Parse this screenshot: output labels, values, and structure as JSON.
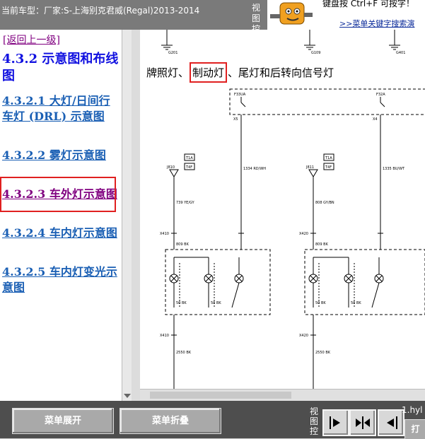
{
  "topbar": {
    "car_model": "当前车型：厂家:S-上海别克君威(Regal)2013-2014",
    "view_label": "视图控制",
    "help_text": "键盘按 Ctrl+F 可按字！",
    "help_link": ">>菜单关键字搜索演"
  },
  "left": {
    "back_link": "[返回上一级]",
    "section_title": "4.3.2 示意图和布线图",
    "items": [
      {
        "label": "4.3.2.1 大灯/日间行车灯 (DRL) 示意图"
      },
      {
        "label": "4.3.2.2 雾灯示意图"
      },
      {
        "label": "4.3.2.3 车外灯示意图"
      },
      {
        "label": "4.3.2.4 车内灯示意图"
      },
      {
        "label": "4.3.2.5 车内灯变光示意图"
      }
    ]
  },
  "diagram": {
    "title_before": "牌照灯、",
    "title_highlight": "制动灯",
    "title_after": "、尾灯和后转向信号灯",
    "labels": {
      "g1": "G201",
      "g2": "G109",
      "g3": "G401",
      "f1": "F33UA",
      "f2": "F32A",
      "x1": "X5",
      "x2": "X4",
      "c1a": "T1A",
      "c1b": "T4F",
      "c2a": "T1A",
      "c2b": "T4F",
      "j1": "J810",
      "j2": "J811",
      "w1": "1334 RD/WH",
      "w2": "1335 BU/WT",
      "w3": "739 YE/GY",
      "w4": "808 GY/BN",
      "k1": "X410",
      "k2": "X420",
      "k3": "X410",
      "k4": "X420",
      "b1": "809 BK",
      "b2": "809 BK",
      "m1": "50 BK",
      "m2": "50 BK",
      "m3": "50 BK",
      "m4": "50 BK",
      "g5": "2550 BK",
      "g6": "2550 BK"
    }
  },
  "bottom": {
    "expand_label": "菜单展开",
    "collapse_label": "菜单折叠",
    "view_label": "视图控",
    "file_name": "1.hyl",
    "corner_label": "打"
  }
}
